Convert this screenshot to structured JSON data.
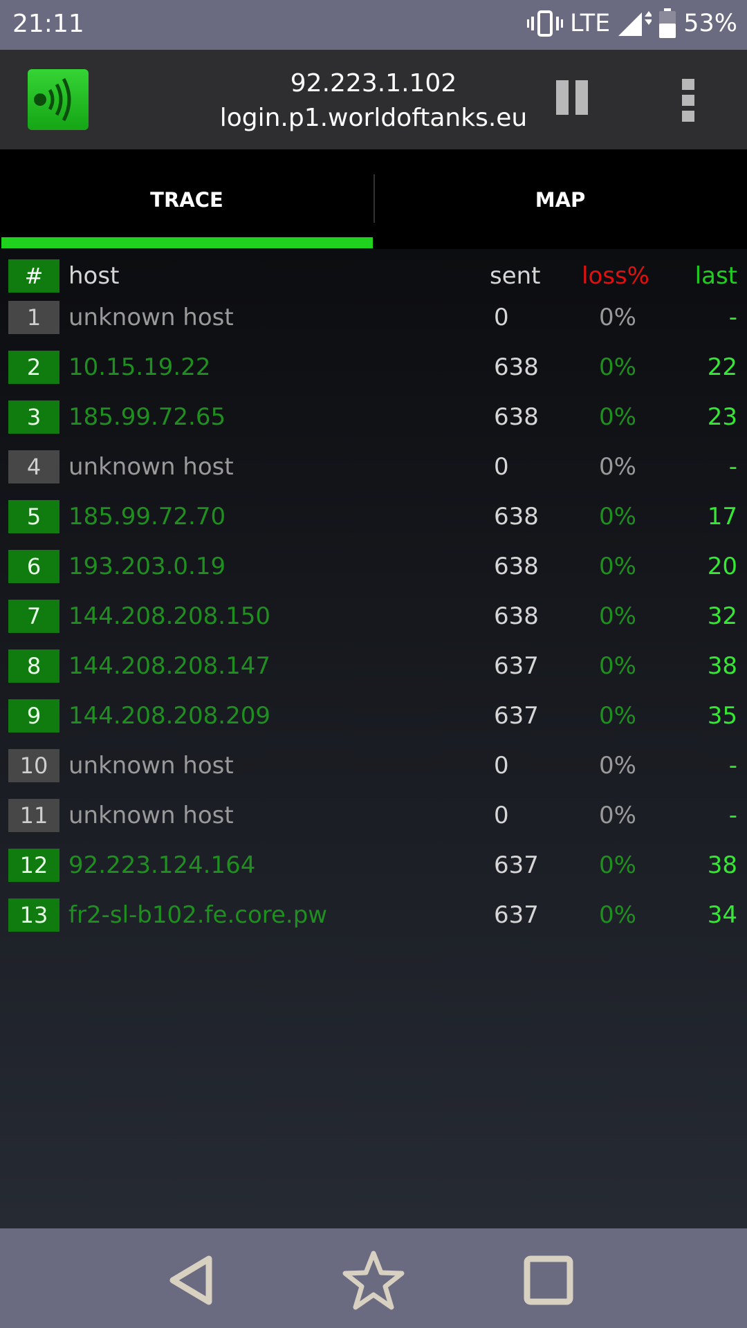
{
  "status": {
    "time": "21:11",
    "network": "LTE",
    "battery": "53%"
  },
  "header": {
    "ip": "92.223.1.102",
    "hostname": "login.p1.worldoftanks.eu"
  },
  "tabs": [
    {
      "label": "TRACE",
      "active": true
    },
    {
      "label": "MAP",
      "active": false
    }
  ],
  "table": {
    "headers": {
      "num": "#",
      "host": "host",
      "sent": "sent",
      "loss": "loss%",
      "last": "last"
    },
    "rows": [
      {
        "n": "1",
        "host": "unknown host",
        "sent": "0",
        "loss": "0%",
        "last": "-",
        "known": false
      },
      {
        "n": "2",
        "host": "10.15.19.22",
        "sent": "638",
        "loss": "0%",
        "last": "22",
        "known": true
      },
      {
        "n": "3",
        "host": "185.99.72.65",
        "sent": "638",
        "loss": "0%",
        "last": "23",
        "known": true
      },
      {
        "n": "4",
        "host": "unknown host",
        "sent": "0",
        "loss": "0%",
        "last": "-",
        "known": false
      },
      {
        "n": "5",
        "host": "185.99.72.70",
        "sent": "638",
        "loss": "0%",
        "last": "17",
        "known": true
      },
      {
        "n": "6",
        "host": "193.203.0.19",
        "sent": "638",
        "loss": "0%",
        "last": "20",
        "known": true
      },
      {
        "n": "7",
        "host": "144.208.208.150",
        "sent": "638",
        "loss": "0%",
        "last": "32",
        "known": true
      },
      {
        "n": "8",
        "host": "144.208.208.147",
        "sent": "637",
        "loss": "0%",
        "last": "38",
        "known": true
      },
      {
        "n": "9",
        "host": "144.208.208.209",
        "sent": "637",
        "loss": "0%",
        "last": "35",
        "known": true
      },
      {
        "n": "10",
        "host": "unknown host",
        "sent": "0",
        "loss": "0%",
        "last": "-",
        "known": false
      },
      {
        "n": "11",
        "host": "unknown host",
        "sent": "0",
        "loss": "0%",
        "last": "-",
        "known": false
      },
      {
        "n": "12",
        "host": "92.223.124.164",
        "sent": "637",
        "loss": "0%",
        "last": "38",
        "known": true
      },
      {
        "n": "13",
        "host": "fr2-sl-b102.fe.core.pw",
        "sent": "637",
        "loss": "0%",
        "last": "34",
        "known": true
      }
    ]
  },
  "colors": {
    "accent": "#1ed21e",
    "known_host": "#1f8f1f",
    "unknown_host": "#9a9a9a",
    "loss_header": "#e01010",
    "last_value": "#34e834"
  },
  "icons": {
    "app": "signal-waves-icon",
    "pause": "pause-icon",
    "menu": "more-vert-icon",
    "back": "back-icon",
    "home": "star-icon",
    "recents": "square-icon"
  }
}
